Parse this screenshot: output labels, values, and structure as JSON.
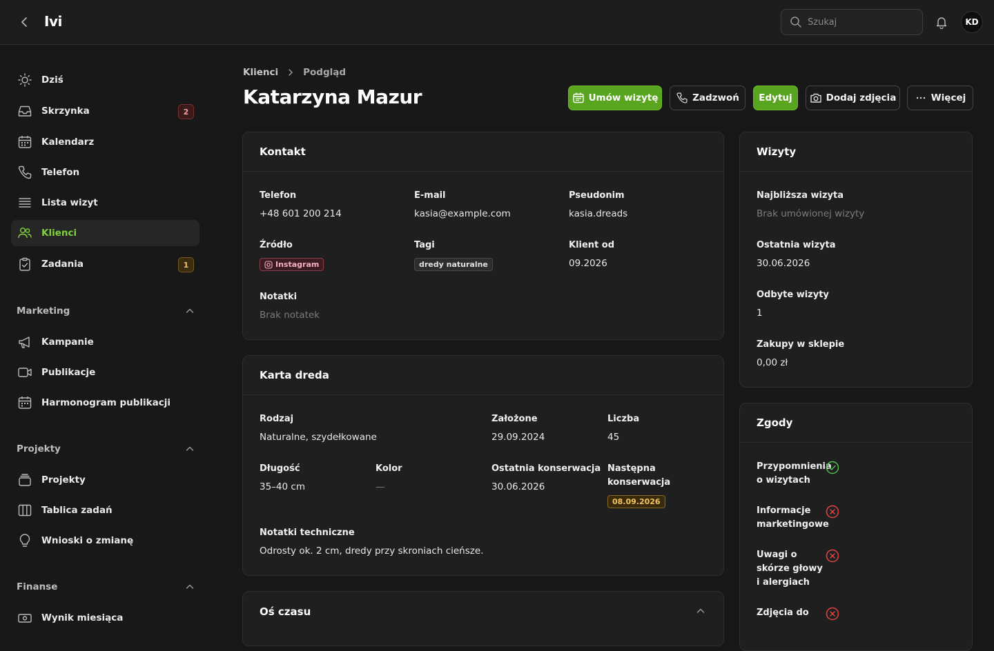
{
  "app": {
    "logo": "Ivi",
    "search_placeholder": "Szukaj",
    "user_initials": "KD"
  },
  "sidebar": {
    "main": [
      {
        "label": "Dziś",
        "icon": "sun-icon"
      },
      {
        "label": "Skrzynka",
        "icon": "inbox-icon",
        "badge": "2",
        "badge_color": "red"
      },
      {
        "label": "Kalendarz",
        "icon": "calendar-icon"
      },
      {
        "label": "Telefon",
        "icon": "phone-icon"
      },
      {
        "label": "Lista wizyt",
        "icon": "list-icon"
      },
      {
        "label": "Klienci",
        "icon": "users-icon",
        "active": true
      },
      {
        "label": "Zadania",
        "icon": "clipboard-icon",
        "badge": "1",
        "badge_color": "amber"
      }
    ],
    "marketing": {
      "title": "Marketing",
      "items": [
        {
          "label": "Kampanie",
          "icon": "megaphone-icon"
        },
        {
          "label": "Publikacje",
          "icon": "video-icon"
        },
        {
          "label": "Harmonogram publikacji",
          "icon": "calendar-icon"
        }
      ]
    },
    "projekty": {
      "title": "Projekty",
      "items": [
        {
          "label": "Projekty",
          "icon": "layers-icon"
        },
        {
          "label": "Tablica zadań",
          "icon": "columns-icon"
        },
        {
          "label": "Wnioski o zmianę",
          "icon": "lightbulb-icon"
        }
      ]
    },
    "finanse": {
      "title": "Finanse",
      "items": [
        {
          "label": "Wynik miesiąca",
          "icon": "cash-icon"
        }
      ]
    }
  },
  "breadcrumb": {
    "parent": "Klienci",
    "current": "Podgląd"
  },
  "page": {
    "title": "Katarzyna Mazur"
  },
  "actions": {
    "schedule": "Umów wizytę",
    "call": "Zadzwoń",
    "edit": "Edytuj",
    "photos": "Dodaj zdjęcia",
    "more": "Więcej"
  },
  "kontakt": {
    "title": "Kontakt",
    "phone_label": "Telefon",
    "phone": "+48 601 200 214",
    "email_label": "E-mail",
    "email": "kasia@example.com",
    "nick_label": "Pseudonim",
    "nick": "kasia.dreads",
    "source_label": "Źródło",
    "source": "Instagram",
    "tags_label": "Tagi",
    "tag": "dredy naturalne",
    "since_label": "Klient od",
    "since": "09.2026",
    "notes_label": "Notatki",
    "notes": "Brak notatek"
  },
  "karta": {
    "title": "Karta dreda",
    "type_label": "Rodzaj",
    "type": "Naturalne, szydełkowane",
    "created_label": "Założone",
    "created": "29.09.2024",
    "count_label": "Liczba",
    "count": "45",
    "length_label": "Długość",
    "length": "35–40 cm",
    "color_label": "Kolor",
    "color": "—",
    "last_label": "Ostatnia konserwacja",
    "last": "30.06.2026",
    "next_label": "Następna konserwacja",
    "next": "08.09.2026",
    "tech_label": "Notatki techniczne",
    "tech": "Odrosty ok. 2 cm, dredy przy skroniach cieńsze."
  },
  "timeline": {
    "title": "Oś czasu"
  },
  "wizyty": {
    "title": "Wizyty",
    "next_label": "Najbliższa wizyta",
    "next": "Brak umówionej wizyty",
    "last_label": "Ostatnia wizyta",
    "last": "30.06.2026",
    "done_label": "Odbyte wizyty",
    "done": "1",
    "shop_label": "Zakupy w sklepie",
    "shop": "0,00 zł"
  },
  "zgody": {
    "title": "Zgody",
    "items": [
      {
        "label": "Przypomnienia o wizytach",
        "status": "yes"
      },
      {
        "label": "Informacje marketingowe",
        "status": "no"
      },
      {
        "label": "Uwagi o skórze głowy i alergiach",
        "status": "no"
      },
      {
        "label": "Zdjęcia do",
        "status": "no"
      }
    ]
  },
  "colors": {
    "accent": "#5aa51f",
    "active_text": "#7fd23a",
    "bg": "#181818",
    "card": "#1f1f1f"
  }
}
